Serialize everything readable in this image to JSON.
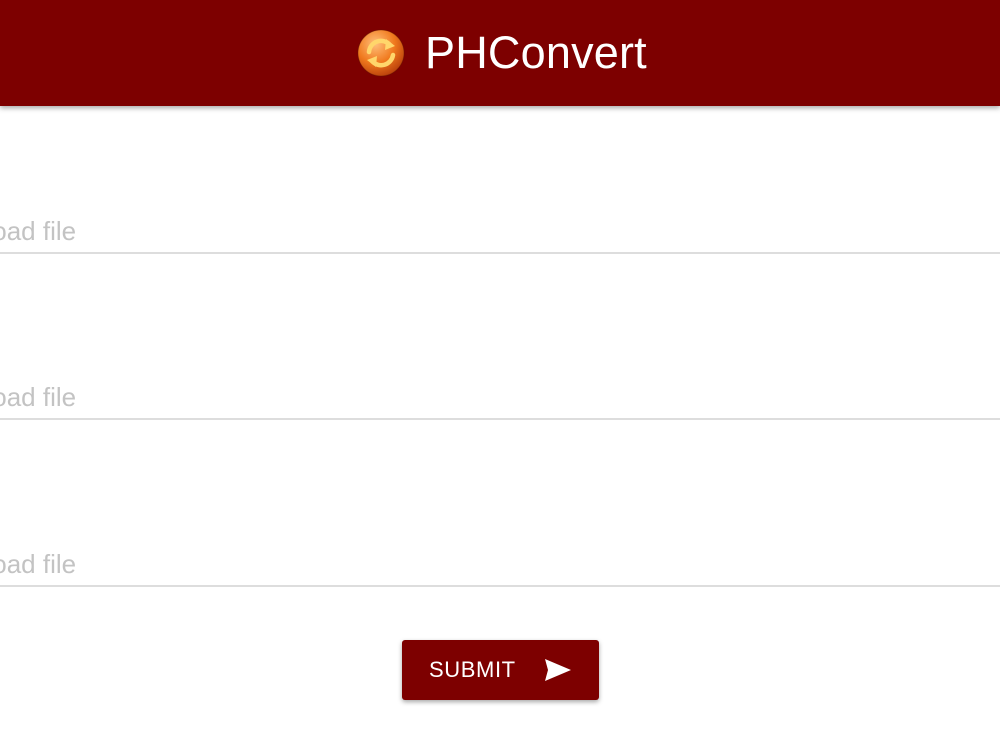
{
  "header": {
    "title": "PHConvert",
    "logo_icon": "convert-arrows-icon",
    "background_color": "#7d0000"
  },
  "form": {
    "fields": [
      {
        "placeholder": "pload file"
      },
      {
        "placeholder": "pload file"
      },
      {
        "placeholder": "pload file"
      }
    ],
    "submit": {
      "label": "SUBMIT",
      "icon": "send-icon",
      "background_color": "#7d0000"
    }
  }
}
